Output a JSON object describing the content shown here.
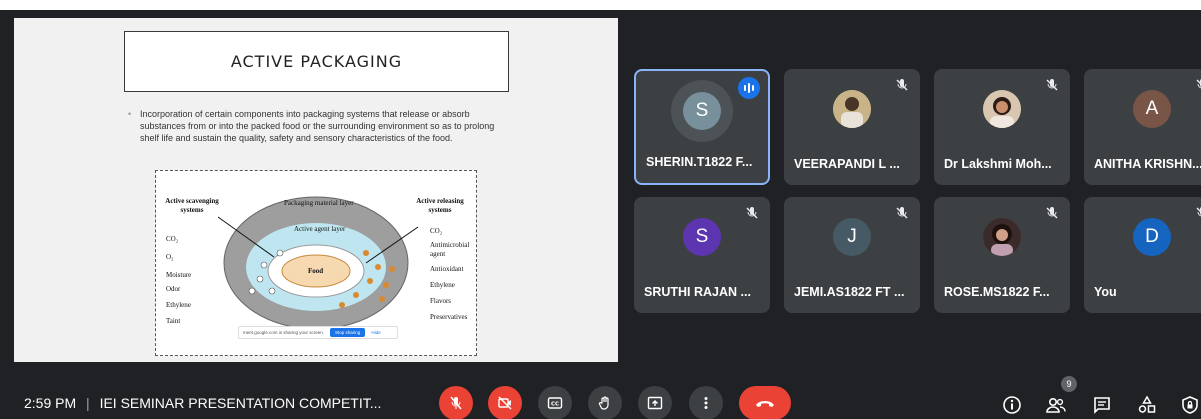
{
  "presentation": {
    "slide_title": "ACTIVE PACKAGING",
    "bullet_text": "Incorporation of certain components into packaging systems that release or absorb substances from or into the packed food or the surrounding environment so as to prolong shelf life and sustain the quality, safety and sensory characteristics of the food.",
    "diagram": {
      "left_heading": "Active scavenging systems",
      "left_items": [
        "CO₂",
        "O₂",
        "Moisture",
        "Odor",
        "Ethylene",
        "Taint"
      ],
      "right_heading": "Active releasing systems",
      "right_items": [
        "CO₂",
        "Antimicrobial agent",
        "Antioxidant",
        "Ethylene",
        "Flavors",
        "Preservatives"
      ],
      "outer_label": "Packaging material layer",
      "inner_label": "Active agent layer",
      "food_label": "Food"
    },
    "share_bar": {
      "text": "meet.google.com is sharing your screen.",
      "stop_label": "Stop sharing",
      "hide_label": "Hide"
    }
  },
  "participants": [
    {
      "name": "SHERIN.T1822 F...",
      "initial": "S",
      "avatar_color": "#78909c",
      "speaking": true,
      "muted": false
    },
    {
      "name": "VEERAPANDI L ...",
      "initial": "",
      "avatar_color": "#b0a080",
      "speaking": false,
      "muted": true
    },
    {
      "name": "Dr Lakshmi Moh...",
      "initial": "",
      "avatar_color": "#8a6a5a",
      "speaking": false,
      "muted": true
    },
    {
      "name": "ANITHA KRISHN...",
      "initial": "A",
      "avatar_color": "#795548",
      "speaking": false,
      "muted": true
    },
    {
      "name": "SRUTHI RAJAN ...",
      "initial": "S",
      "avatar_color": "#5e35b1",
      "speaking": false,
      "muted": true
    },
    {
      "name": "JEMI.AS1822 FT ...",
      "initial": "J",
      "avatar_color": "#455a64",
      "speaking": false,
      "muted": true
    },
    {
      "name": "ROSE.MS1822 F...",
      "initial": "",
      "avatar_color": "#6a4a4a",
      "speaking": false,
      "muted": true
    },
    {
      "name": "You",
      "initial": "D",
      "avatar_color": "#1565c0",
      "speaking": false,
      "muted": true
    }
  ],
  "bottom_bar": {
    "time": "2:59 PM",
    "separator": "|",
    "meeting_title": "IEI SEMINAR PRESENTATION COMPETIT...",
    "participant_count": "9"
  },
  "colors": {
    "background": "#202124",
    "tile": "#3c4043",
    "accent": "#8ab4f8",
    "danger": "#ea4335",
    "speaking": "#1a73e8"
  }
}
